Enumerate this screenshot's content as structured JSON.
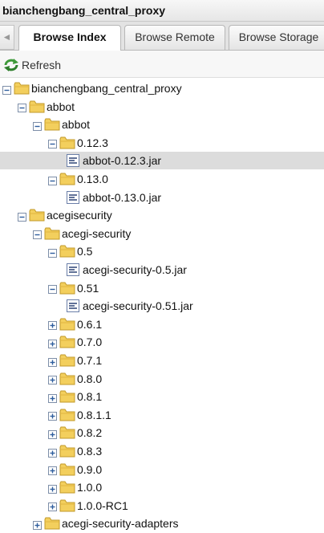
{
  "window": {
    "title": "bianchengbang_central_proxy"
  },
  "tabs": [
    {
      "label": "Browse Index",
      "active": true
    },
    {
      "label": "Browse Remote",
      "active": false
    },
    {
      "label": "Browse Storage",
      "active": false
    }
  ],
  "toolbar": {
    "refresh_label": "Refresh"
  },
  "colors": {
    "folder": "#f3cf5d",
    "selected_row": "#dcdcdc",
    "expander_blue": "#2e5e9e"
  },
  "tree": [
    {
      "label": "bianchengbang_central_proxy",
      "type": "folder",
      "depth": 0,
      "state": "expanded"
    },
    {
      "label": "abbot",
      "type": "folder",
      "depth": 1,
      "state": "expanded"
    },
    {
      "label": "abbot",
      "type": "folder",
      "depth": 2,
      "state": "expanded"
    },
    {
      "label": "0.12.3",
      "type": "folder",
      "depth": 3,
      "state": "expanded"
    },
    {
      "label": "abbot-0.12.3.jar",
      "type": "file",
      "depth": 4,
      "selected": true
    },
    {
      "label": "0.13.0",
      "type": "folder",
      "depth": 3,
      "state": "expanded"
    },
    {
      "label": "abbot-0.13.0.jar",
      "type": "file",
      "depth": 4
    },
    {
      "label": "acegisecurity",
      "type": "folder",
      "depth": 1,
      "state": "expanded"
    },
    {
      "label": "acegi-security",
      "type": "folder",
      "depth": 2,
      "state": "expanded"
    },
    {
      "label": "0.5",
      "type": "folder",
      "depth": 3,
      "state": "expanded"
    },
    {
      "label": "acegi-security-0.5.jar",
      "type": "file",
      "depth": 4
    },
    {
      "label": "0.51",
      "type": "folder",
      "depth": 3,
      "state": "expanded"
    },
    {
      "label": "acegi-security-0.51.jar",
      "type": "file",
      "depth": 4
    },
    {
      "label": "0.6.1",
      "type": "folder",
      "depth": 3,
      "state": "collapsed"
    },
    {
      "label": "0.7.0",
      "type": "folder",
      "depth": 3,
      "state": "collapsed"
    },
    {
      "label": "0.7.1",
      "type": "folder",
      "depth": 3,
      "state": "collapsed"
    },
    {
      "label": "0.8.0",
      "type": "folder",
      "depth": 3,
      "state": "collapsed"
    },
    {
      "label": "0.8.1",
      "type": "folder",
      "depth": 3,
      "state": "collapsed"
    },
    {
      "label": "0.8.1.1",
      "type": "folder",
      "depth": 3,
      "state": "collapsed"
    },
    {
      "label": "0.8.2",
      "type": "folder",
      "depth": 3,
      "state": "collapsed"
    },
    {
      "label": "0.8.3",
      "type": "folder",
      "depth": 3,
      "state": "collapsed"
    },
    {
      "label": "0.9.0",
      "type": "folder",
      "depth": 3,
      "state": "collapsed"
    },
    {
      "label": "1.0.0",
      "type": "folder",
      "depth": 3,
      "state": "collapsed"
    },
    {
      "label": "1.0.0-RC1",
      "type": "folder",
      "depth": 3,
      "state": "collapsed"
    },
    {
      "label": "acegi-security-adapters",
      "type": "folder",
      "depth": 2,
      "state": "collapsed"
    }
  ]
}
